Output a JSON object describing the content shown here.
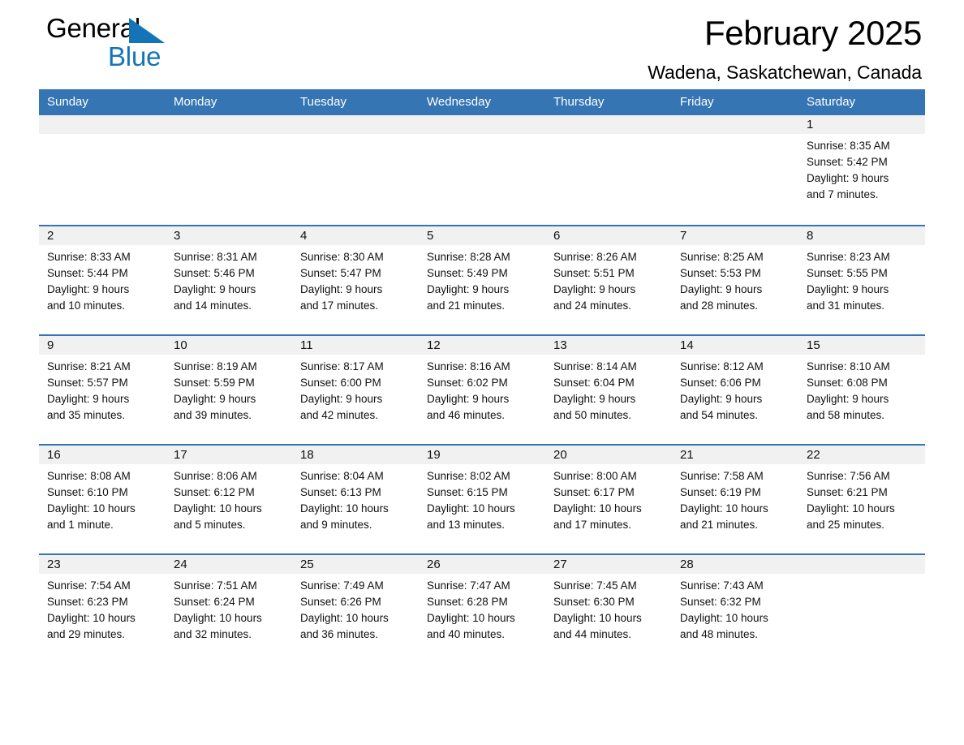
{
  "brand": {
    "name_part1": "General",
    "name_part2": "Blue",
    "triangle_color": "#1574b8"
  },
  "header": {
    "title": "February 2025",
    "subtitle": "Wadena, Saskatchewan, Canada",
    "accent_color": "#3575b3",
    "daynum_background": "#f1f1f1"
  },
  "weekdays": [
    "Sunday",
    "Monday",
    "Tuesday",
    "Wednesday",
    "Thursday",
    "Friday",
    "Saturday"
  ],
  "labels": {
    "sunrise_prefix": "Sunrise: ",
    "sunset_prefix": "Sunset: ",
    "daylight_prefix": "Daylight: "
  },
  "weeks": [
    [
      {
        "blank": true
      },
      {
        "blank": true
      },
      {
        "blank": true
      },
      {
        "blank": true
      },
      {
        "blank": true
      },
      {
        "blank": true
      },
      {
        "day": "1",
        "sunrise": "Sunrise: 8:35 AM",
        "sunset": "Sunset: 5:42 PM",
        "daylight_line1": "Daylight: 9 hours",
        "daylight_line2": "and 7 minutes."
      }
    ],
    [
      {
        "day": "2",
        "sunrise": "Sunrise: 8:33 AM",
        "sunset": "Sunset: 5:44 PM",
        "daylight_line1": "Daylight: 9 hours",
        "daylight_line2": "and 10 minutes."
      },
      {
        "day": "3",
        "sunrise": "Sunrise: 8:31 AM",
        "sunset": "Sunset: 5:46 PM",
        "daylight_line1": "Daylight: 9 hours",
        "daylight_line2": "and 14 minutes."
      },
      {
        "day": "4",
        "sunrise": "Sunrise: 8:30 AM",
        "sunset": "Sunset: 5:47 PM",
        "daylight_line1": "Daylight: 9 hours",
        "daylight_line2": "and 17 minutes."
      },
      {
        "day": "5",
        "sunrise": "Sunrise: 8:28 AM",
        "sunset": "Sunset: 5:49 PM",
        "daylight_line1": "Daylight: 9 hours",
        "daylight_line2": "and 21 minutes."
      },
      {
        "day": "6",
        "sunrise": "Sunrise: 8:26 AM",
        "sunset": "Sunset: 5:51 PM",
        "daylight_line1": "Daylight: 9 hours",
        "daylight_line2": "and 24 minutes."
      },
      {
        "day": "7",
        "sunrise": "Sunrise: 8:25 AM",
        "sunset": "Sunset: 5:53 PM",
        "daylight_line1": "Daylight: 9 hours",
        "daylight_line2": "and 28 minutes."
      },
      {
        "day": "8",
        "sunrise": "Sunrise: 8:23 AM",
        "sunset": "Sunset: 5:55 PM",
        "daylight_line1": "Daylight: 9 hours",
        "daylight_line2": "and 31 minutes."
      }
    ],
    [
      {
        "day": "9",
        "sunrise": "Sunrise: 8:21 AM",
        "sunset": "Sunset: 5:57 PM",
        "daylight_line1": "Daylight: 9 hours",
        "daylight_line2": "and 35 minutes."
      },
      {
        "day": "10",
        "sunrise": "Sunrise: 8:19 AM",
        "sunset": "Sunset: 5:59 PM",
        "daylight_line1": "Daylight: 9 hours",
        "daylight_line2": "and 39 minutes."
      },
      {
        "day": "11",
        "sunrise": "Sunrise: 8:17 AM",
        "sunset": "Sunset: 6:00 PM",
        "daylight_line1": "Daylight: 9 hours",
        "daylight_line2": "and 42 minutes."
      },
      {
        "day": "12",
        "sunrise": "Sunrise: 8:16 AM",
        "sunset": "Sunset: 6:02 PM",
        "daylight_line1": "Daylight: 9 hours",
        "daylight_line2": "and 46 minutes."
      },
      {
        "day": "13",
        "sunrise": "Sunrise: 8:14 AM",
        "sunset": "Sunset: 6:04 PM",
        "daylight_line1": "Daylight: 9 hours",
        "daylight_line2": "and 50 minutes."
      },
      {
        "day": "14",
        "sunrise": "Sunrise: 8:12 AM",
        "sunset": "Sunset: 6:06 PM",
        "daylight_line1": "Daylight: 9 hours",
        "daylight_line2": "and 54 minutes."
      },
      {
        "day": "15",
        "sunrise": "Sunrise: 8:10 AM",
        "sunset": "Sunset: 6:08 PM",
        "daylight_line1": "Daylight: 9 hours",
        "daylight_line2": "and 58 minutes."
      }
    ],
    [
      {
        "day": "16",
        "sunrise": "Sunrise: 8:08 AM",
        "sunset": "Sunset: 6:10 PM",
        "daylight_line1": "Daylight: 10 hours",
        "daylight_line2": "and 1 minute."
      },
      {
        "day": "17",
        "sunrise": "Sunrise: 8:06 AM",
        "sunset": "Sunset: 6:12 PM",
        "daylight_line1": "Daylight: 10 hours",
        "daylight_line2": "and 5 minutes."
      },
      {
        "day": "18",
        "sunrise": "Sunrise: 8:04 AM",
        "sunset": "Sunset: 6:13 PM",
        "daylight_line1": "Daylight: 10 hours",
        "daylight_line2": "and 9 minutes."
      },
      {
        "day": "19",
        "sunrise": "Sunrise: 8:02 AM",
        "sunset": "Sunset: 6:15 PM",
        "daylight_line1": "Daylight: 10 hours",
        "daylight_line2": "and 13 minutes."
      },
      {
        "day": "20",
        "sunrise": "Sunrise: 8:00 AM",
        "sunset": "Sunset: 6:17 PM",
        "daylight_line1": "Daylight: 10 hours",
        "daylight_line2": "and 17 minutes."
      },
      {
        "day": "21",
        "sunrise": "Sunrise: 7:58 AM",
        "sunset": "Sunset: 6:19 PM",
        "daylight_line1": "Daylight: 10 hours",
        "daylight_line2": "and 21 minutes."
      },
      {
        "day": "22",
        "sunrise": "Sunrise: 7:56 AM",
        "sunset": "Sunset: 6:21 PM",
        "daylight_line1": "Daylight: 10 hours",
        "daylight_line2": "and 25 minutes."
      }
    ],
    [
      {
        "day": "23",
        "sunrise": "Sunrise: 7:54 AM",
        "sunset": "Sunset: 6:23 PM",
        "daylight_line1": "Daylight: 10 hours",
        "daylight_line2": "and 29 minutes."
      },
      {
        "day": "24",
        "sunrise": "Sunrise: 7:51 AM",
        "sunset": "Sunset: 6:24 PM",
        "daylight_line1": "Daylight: 10 hours",
        "daylight_line2": "and 32 minutes."
      },
      {
        "day": "25",
        "sunrise": "Sunrise: 7:49 AM",
        "sunset": "Sunset: 6:26 PM",
        "daylight_line1": "Daylight: 10 hours",
        "daylight_line2": "and 36 minutes."
      },
      {
        "day": "26",
        "sunrise": "Sunrise: 7:47 AM",
        "sunset": "Sunset: 6:28 PM",
        "daylight_line1": "Daylight: 10 hours",
        "daylight_line2": "and 40 minutes."
      },
      {
        "day": "27",
        "sunrise": "Sunrise: 7:45 AM",
        "sunset": "Sunset: 6:30 PM",
        "daylight_line1": "Daylight: 10 hours",
        "daylight_line2": "and 44 minutes."
      },
      {
        "day": "28",
        "sunrise": "Sunrise: 7:43 AM",
        "sunset": "Sunset: 6:32 PM",
        "daylight_line1": "Daylight: 10 hours",
        "daylight_line2": "and 48 minutes."
      },
      {
        "blank": true
      }
    ]
  ]
}
